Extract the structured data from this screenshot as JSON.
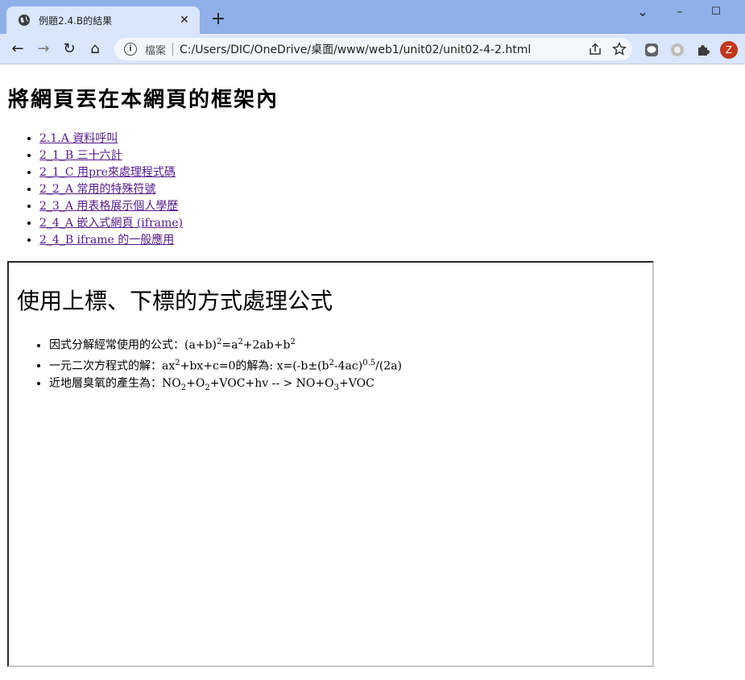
{
  "browser": {
    "tab_title": "例題2.4.B的結果",
    "tab_close": "✕",
    "new_tab": "+",
    "window_controls": {
      "dropdown": "⌄",
      "minimize": "–",
      "maximize": "☐",
      "close": "✕"
    },
    "nav": {
      "back": "←",
      "forward": "→",
      "reload": "↻",
      "home": "⌂"
    },
    "address": {
      "security_label": "檔案",
      "url": "C:/Users/DIC/OneDrive/桌面/www/web1/unit02/unit02-4-2.html"
    },
    "icons": [
      "info-icon",
      "share-icon",
      "star-icon",
      "line-icon",
      "extension-gray-icon",
      "puzzle-icon"
    ],
    "profile_initial": "Z",
    "profile_color": "#c0371c"
  },
  "page": {
    "title": "將網頁丟在本網頁的框架內",
    "links": [
      "2.1.A 資料呼叫",
      "2_1_B 三十六計",
      "2_1_C 用pre來處理程式碼",
      "2_2_A 常用的特殊符號",
      "2_3_A 用表格展示個人學歷",
      "2_4_A 嵌入式網頁 (iframe)",
      "2_4_B iframe 的一般應用"
    ],
    "link_color": "#551a8b"
  },
  "iframe": {
    "heading": "使用上標、下標的方式處理公式",
    "formulas": {
      "f1": {
        "label": "因式分解經常使用的公式：",
        "p1": "(a+b)",
        "s1": "2",
        "p2": "=a",
        "s2": "2",
        "p3": "+2ab+b",
        "s3": "2"
      },
      "f2": {
        "label": "一元二次方程式的解：",
        "p1": "ax",
        "s1": "2",
        "p2": "+bx+c=0的解為: x=(-b±(b",
        "s2": "2",
        "p3": "-4ac)",
        "s3": "0.5",
        "p4": "/(2a)"
      },
      "f3": {
        "label": "近地層臭氧的產生為：",
        "p1": "NO",
        "s1": "2",
        "p2": "+O",
        "s2": "2",
        "p3": "+VOC+hv -- > NO+O",
        "s3": "3",
        "p4": "+VOC"
      }
    }
  }
}
